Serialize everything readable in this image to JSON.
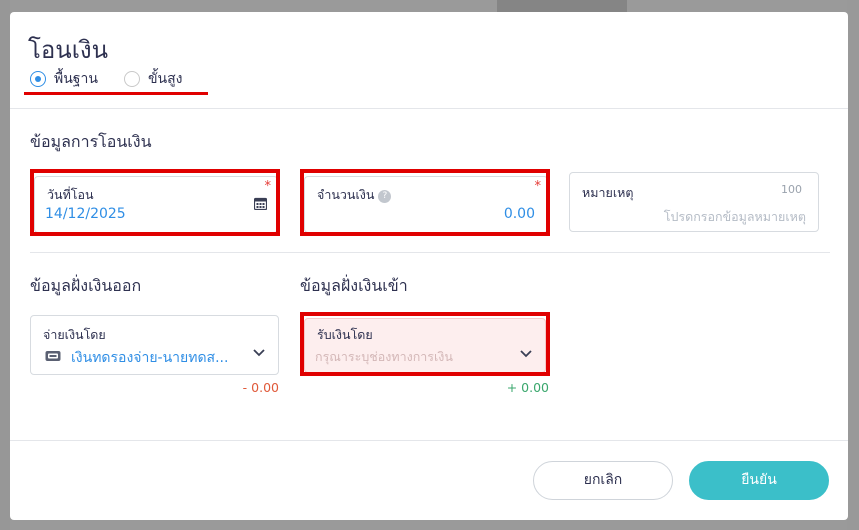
{
  "dialog": {
    "title": "โอนเงิน",
    "modes": [
      {
        "label": "พื้นฐาน",
        "selected": true
      },
      {
        "label": "ขั้นสูง",
        "selected": false
      }
    ]
  },
  "transfer_info": {
    "section_title": "ข้อมูลการโอนเงิน",
    "date": {
      "label": "วันที่โอน",
      "value": "14/12/2025",
      "required_mark": "*"
    },
    "amount": {
      "label": "จำนวนเงิน",
      "value": "0.00",
      "required_mark": "*",
      "help_icon": "?"
    },
    "note": {
      "label": "หมายเหตุ",
      "max_length": "100",
      "placeholder": "โปรดกรอกข้อมูลหมายเหตุ"
    }
  },
  "outgoing": {
    "section_title": "ข้อมูลฝั่งเงินออก",
    "label": "จ่ายเงินโดย",
    "value": "เงินทดรองจ่าย-นายทดส...",
    "balance": "- 0.00",
    "icon": "wallet-icon"
  },
  "incoming": {
    "section_title": "ข้อมูลฝั่งเงินเข้า",
    "label": "รับเงินโดย",
    "placeholder": "กรุณาระบุช่องทางการเงิน",
    "balance": "+ 0.00"
  },
  "footer": {
    "cancel_label": "ยกเลิก",
    "confirm_label": "ยืนยัน"
  },
  "colors": {
    "accent": "#2f8ee5",
    "confirm": "#3bbfc9",
    "highlight": "#e00000",
    "negative": "#e05a3a",
    "positive": "#3aa76d"
  }
}
